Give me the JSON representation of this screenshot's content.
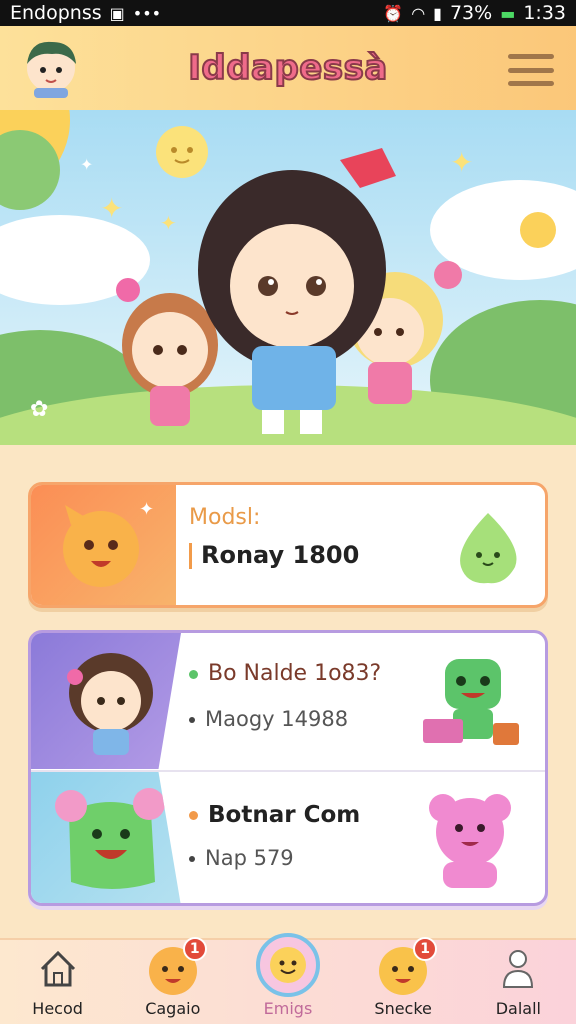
{
  "status_bar": {
    "app_name": "Endopnss",
    "time": "1:33",
    "battery": "73%"
  },
  "header": {
    "title": "Iddapessà"
  },
  "card1": {
    "label": "Modsl:",
    "value": "Ronay 1800"
  },
  "card2": {
    "row1": {
      "title": "Bo Nalde 1o83?",
      "subtitle": "Maogy 14988"
    },
    "row2": {
      "title": "Botnar Com",
      "subtitle": "Nap 579"
    }
  },
  "nav": {
    "items": [
      {
        "label": "Hecod",
        "icon": "home-icon",
        "badge": ""
      },
      {
        "label": "Cagaio",
        "icon": "face-icon",
        "badge": "1"
      },
      {
        "label": "Emigs",
        "icon": "smile-icon",
        "badge": ""
      },
      {
        "label": "Snecke",
        "icon": "face-icon",
        "badge": "1"
      },
      {
        "label": "Dalall",
        "icon": "person-icon",
        "badge": ""
      }
    ]
  },
  "colors": {
    "accent": "#ef6b8a",
    "card1_border": "#f6a56a",
    "card2_border": "#b79be0",
    "nav_active": "#7ac2e8"
  }
}
